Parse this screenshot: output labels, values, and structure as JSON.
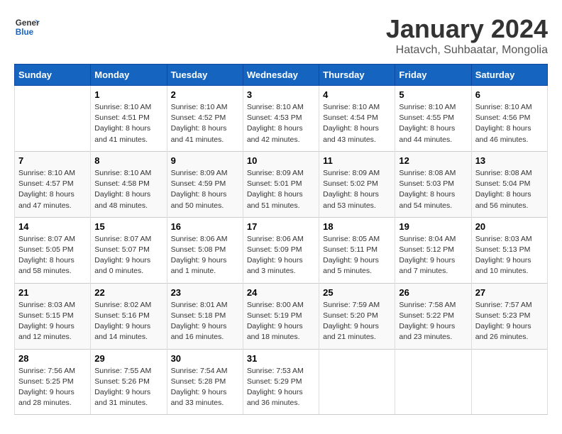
{
  "header": {
    "logo_line1": "General",
    "logo_line2": "Blue",
    "month": "January 2024",
    "location": "Hatavch, Suhbaatar, Mongolia"
  },
  "days_of_week": [
    "Sunday",
    "Monday",
    "Tuesday",
    "Wednesday",
    "Thursday",
    "Friday",
    "Saturday"
  ],
  "weeks": [
    [
      {
        "day": "",
        "info": ""
      },
      {
        "day": "1",
        "info": "Sunrise: 8:10 AM\nSunset: 4:51 PM\nDaylight: 8 hours\nand 41 minutes."
      },
      {
        "day": "2",
        "info": "Sunrise: 8:10 AM\nSunset: 4:52 PM\nDaylight: 8 hours\nand 41 minutes."
      },
      {
        "day": "3",
        "info": "Sunrise: 8:10 AM\nSunset: 4:53 PM\nDaylight: 8 hours\nand 42 minutes."
      },
      {
        "day": "4",
        "info": "Sunrise: 8:10 AM\nSunset: 4:54 PM\nDaylight: 8 hours\nand 43 minutes."
      },
      {
        "day": "5",
        "info": "Sunrise: 8:10 AM\nSunset: 4:55 PM\nDaylight: 8 hours\nand 44 minutes."
      },
      {
        "day": "6",
        "info": "Sunrise: 8:10 AM\nSunset: 4:56 PM\nDaylight: 8 hours\nand 46 minutes."
      }
    ],
    [
      {
        "day": "7",
        "info": "Sunrise: 8:10 AM\nSunset: 4:57 PM\nDaylight: 8 hours\nand 47 minutes."
      },
      {
        "day": "8",
        "info": "Sunrise: 8:10 AM\nSunset: 4:58 PM\nDaylight: 8 hours\nand 48 minutes."
      },
      {
        "day": "9",
        "info": "Sunrise: 8:09 AM\nSunset: 4:59 PM\nDaylight: 8 hours\nand 50 minutes."
      },
      {
        "day": "10",
        "info": "Sunrise: 8:09 AM\nSunset: 5:01 PM\nDaylight: 8 hours\nand 51 minutes."
      },
      {
        "day": "11",
        "info": "Sunrise: 8:09 AM\nSunset: 5:02 PM\nDaylight: 8 hours\nand 53 minutes."
      },
      {
        "day": "12",
        "info": "Sunrise: 8:08 AM\nSunset: 5:03 PM\nDaylight: 8 hours\nand 54 minutes."
      },
      {
        "day": "13",
        "info": "Sunrise: 8:08 AM\nSunset: 5:04 PM\nDaylight: 8 hours\nand 56 minutes."
      }
    ],
    [
      {
        "day": "14",
        "info": "Sunrise: 8:07 AM\nSunset: 5:05 PM\nDaylight: 8 hours\nand 58 minutes."
      },
      {
        "day": "15",
        "info": "Sunrise: 8:07 AM\nSunset: 5:07 PM\nDaylight: 9 hours\nand 0 minutes."
      },
      {
        "day": "16",
        "info": "Sunrise: 8:06 AM\nSunset: 5:08 PM\nDaylight: 9 hours\nand 1 minute."
      },
      {
        "day": "17",
        "info": "Sunrise: 8:06 AM\nSunset: 5:09 PM\nDaylight: 9 hours\nand 3 minutes."
      },
      {
        "day": "18",
        "info": "Sunrise: 8:05 AM\nSunset: 5:11 PM\nDaylight: 9 hours\nand 5 minutes."
      },
      {
        "day": "19",
        "info": "Sunrise: 8:04 AM\nSunset: 5:12 PM\nDaylight: 9 hours\nand 7 minutes."
      },
      {
        "day": "20",
        "info": "Sunrise: 8:03 AM\nSunset: 5:13 PM\nDaylight: 9 hours\nand 10 minutes."
      }
    ],
    [
      {
        "day": "21",
        "info": "Sunrise: 8:03 AM\nSunset: 5:15 PM\nDaylight: 9 hours\nand 12 minutes."
      },
      {
        "day": "22",
        "info": "Sunrise: 8:02 AM\nSunset: 5:16 PM\nDaylight: 9 hours\nand 14 minutes."
      },
      {
        "day": "23",
        "info": "Sunrise: 8:01 AM\nSunset: 5:18 PM\nDaylight: 9 hours\nand 16 minutes."
      },
      {
        "day": "24",
        "info": "Sunrise: 8:00 AM\nSunset: 5:19 PM\nDaylight: 9 hours\nand 18 minutes."
      },
      {
        "day": "25",
        "info": "Sunrise: 7:59 AM\nSunset: 5:20 PM\nDaylight: 9 hours\nand 21 minutes."
      },
      {
        "day": "26",
        "info": "Sunrise: 7:58 AM\nSunset: 5:22 PM\nDaylight: 9 hours\nand 23 minutes."
      },
      {
        "day": "27",
        "info": "Sunrise: 7:57 AM\nSunset: 5:23 PM\nDaylight: 9 hours\nand 26 minutes."
      }
    ],
    [
      {
        "day": "28",
        "info": "Sunrise: 7:56 AM\nSunset: 5:25 PM\nDaylight: 9 hours\nand 28 minutes."
      },
      {
        "day": "29",
        "info": "Sunrise: 7:55 AM\nSunset: 5:26 PM\nDaylight: 9 hours\nand 31 minutes."
      },
      {
        "day": "30",
        "info": "Sunrise: 7:54 AM\nSunset: 5:28 PM\nDaylight: 9 hours\nand 33 minutes."
      },
      {
        "day": "31",
        "info": "Sunrise: 7:53 AM\nSunset: 5:29 PM\nDaylight: 9 hours\nand 36 minutes."
      },
      {
        "day": "",
        "info": ""
      },
      {
        "day": "",
        "info": ""
      },
      {
        "day": "",
        "info": ""
      }
    ]
  ]
}
